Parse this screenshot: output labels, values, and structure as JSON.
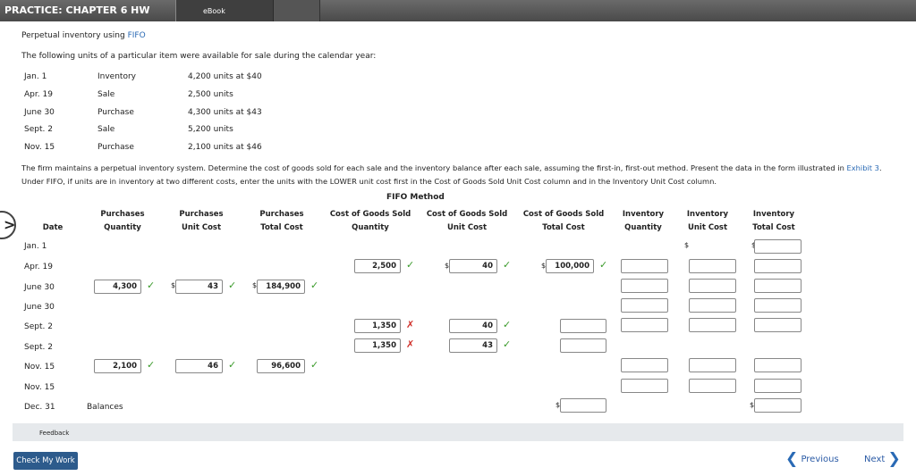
{
  "header": {
    "title": "PRACTICE: CHAPTER 6 HW",
    "tab_ebook": "eBook"
  },
  "problem": {
    "heading": "Perpetual inventory using ",
    "heading_link": "FIFO",
    "intro": "The following units of a particular item were available for sale during the calendar year:",
    "transactions": [
      {
        "date": "Jan. 1",
        "type": "Inventory",
        "detail": "4,200 units at $40"
      },
      {
        "date": "Apr. 19",
        "type": "Sale",
        "detail": "2,500 units"
      },
      {
        "date": "June 30",
        "type": "Purchase",
        "detail": "4,300 units at $43"
      },
      {
        "date": "Sept. 2",
        "type": "Sale",
        "detail": "5,200 units"
      },
      {
        "date": "Nov. 15",
        "type": "Purchase",
        "detail": "2,100 units at $46"
      }
    ],
    "instructions_1": "The firm maintains a perpetual inventory system. Determine the cost of goods sold for each sale and the inventory balance after each sale, assuming the first-in, first-out method. Present the data in the form illustrated in",
    "instructions_link": "Exhibit 3",
    "instructions_2": ". Under FIFO, if units are in inventory at two different costs, enter the units with the LOWER unit cost first in the Cost of Goods Sold Unit Cost column and in the Inventory Unit Cost column."
  },
  "table": {
    "title": "FIFO Method",
    "headers": {
      "date": "Date",
      "p_qty": [
        "Purchases",
        "Quantity"
      ],
      "p_uc": [
        "Purchases",
        "Unit Cost"
      ],
      "p_tc": [
        "Purchases",
        "Total Cost"
      ],
      "c_qty": [
        "Cost of Goods Sold",
        "Quantity"
      ],
      "c_uc": [
        "Cost of Goods Sold",
        "Unit Cost"
      ],
      "c_tc": [
        "Cost of Goods Sold",
        "Total Cost"
      ],
      "i_qty": [
        "Inventory",
        "Quantity"
      ],
      "i_uc": [
        "Inventory",
        "Unit Cost"
      ],
      "i_tc": [
        "Inventory",
        "Total Cost"
      ]
    },
    "rows": [
      {
        "date": "Jan. 1"
      },
      {
        "date": "Apr. 19"
      },
      {
        "date": "June 30"
      },
      {
        "date": "June 30"
      },
      {
        "date": "Sept. 2"
      },
      {
        "date": "Sept. 2"
      },
      {
        "date": "Nov. 15"
      },
      {
        "date": "Nov. 15"
      },
      {
        "date": "Dec. 31",
        "label": "Balances"
      }
    ],
    "values": {
      "apr19_c_qty": "2,500",
      "apr19_c_uc": "40",
      "apr19_c_tc": "100,000",
      "jun30_p_qty": "4,300",
      "jun30_p_uc": "43",
      "jun30_p_tc": "184,900",
      "sep2a_c_qty": "1,350",
      "sep2a_c_uc": "40",
      "sep2b_c_qty": "1,350",
      "sep2b_c_uc": "43",
      "nov15_p_qty": "2,100",
      "nov15_p_uc": "46",
      "nov15_p_tc": "96,600"
    },
    "dollar": "$",
    "check_mark": "✓",
    "cross_mark": "✗"
  },
  "footer": {
    "feedback": "Feedback",
    "check_button": "Check My Work",
    "previous": "Previous",
    "next": "Next"
  },
  "colors": {
    "check": "#3a9a2a",
    "cross": "#d0302a",
    "link": "#2a6ab5",
    "button": "#2d5b8c"
  }
}
